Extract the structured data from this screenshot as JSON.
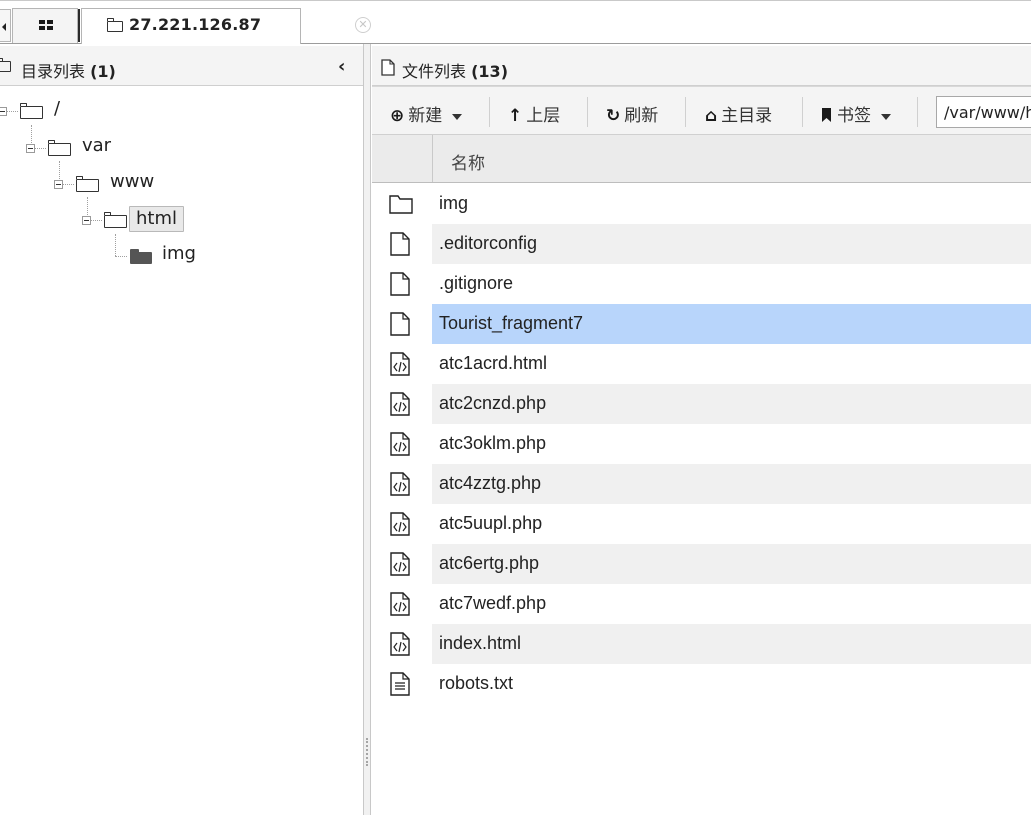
{
  "tabs": {
    "host": "27.221.126.87"
  },
  "directory_panel": {
    "title_text": "目录列表",
    "count_text": "(1)",
    "collapse_glyph": "‹",
    "tree": [
      {
        "label": "/",
        "depth": 0,
        "expanded": true,
        "selected": false
      },
      {
        "label": "var",
        "depth": 1,
        "expanded": true,
        "selected": false
      },
      {
        "label": "www",
        "depth": 2,
        "expanded": true,
        "selected": false
      },
      {
        "label": "html",
        "depth": 3,
        "expanded": true,
        "selected": true
      },
      {
        "label": "img",
        "depth": 4,
        "expanded": false,
        "selected": false
      }
    ]
  },
  "file_panel": {
    "title_text": "文件列表",
    "count_text": "(13)",
    "toolbar": {
      "new_label": "新建",
      "up_label": "上层",
      "refresh_label": "刷新",
      "home_label": "主目录",
      "bookmark_label": "书签",
      "path_value": "/var/www/html/"
    },
    "column_name": "名称",
    "files": [
      {
        "name": "img",
        "icon": "folder-icon"
      },
      {
        "name": ".editorconfig",
        "icon": "file-icon"
      },
      {
        "name": ".gitignore",
        "icon": "file-icon"
      },
      {
        "name": "Tourist_fragment7",
        "icon": "file-icon"
      },
      {
        "name": "atc1acrd.html",
        "icon": "code-file-icon"
      },
      {
        "name": "atc2cnzd.php",
        "icon": "code-file-icon"
      },
      {
        "name": "atc3oklm.php",
        "icon": "code-file-icon"
      },
      {
        "name": "atc4zztg.php",
        "icon": "code-file-icon"
      },
      {
        "name": "atc5uupl.php",
        "icon": "code-file-icon"
      },
      {
        "name": "atc6ertg.php",
        "icon": "code-file-icon"
      },
      {
        "name": "atc7wedf.php",
        "icon": "code-file-icon"
      },
      {
        "name": "index.html",
        "icon": "code-file-icon"
      },
      {
        "name": "robots.txt",
        "icon": "text-file-icon"
      }
    ],
    "selected_file": "Tourist_fragment7"
  },
  "colors": {
    "selection": "#b8d5fb",
    "stripe": "#f0f0f0",
    "header_bg": "#f4f4f4"
  }
}
